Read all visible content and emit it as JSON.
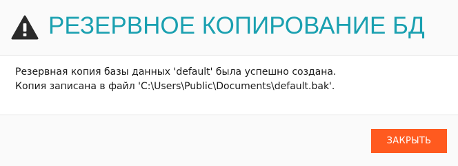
{
  "dialog": {
    "title": "РЕЗЕРВНОЕ КОПИРОВАНИЕ БД",
    "icon": "warning-icon",
    "message_lines": [
      "Резервная копия базы данных 'default' была успешно создана.",
      "Копия записана в файл 'C:\\Users\\Public\\Documents\\default.bak'."
    ],
    "close_label": "ЗАКРЫТЬ"
  },
  "colors": {
    "title": "#1aa0b0",
    "icon": "#2b2b2b",
    "button_bg": "#ff5a1f",
    "button_text": "#ffffff",
    "header_bg": "#fafafa",
    "footer_bg": "#fafafa"
  }
}
